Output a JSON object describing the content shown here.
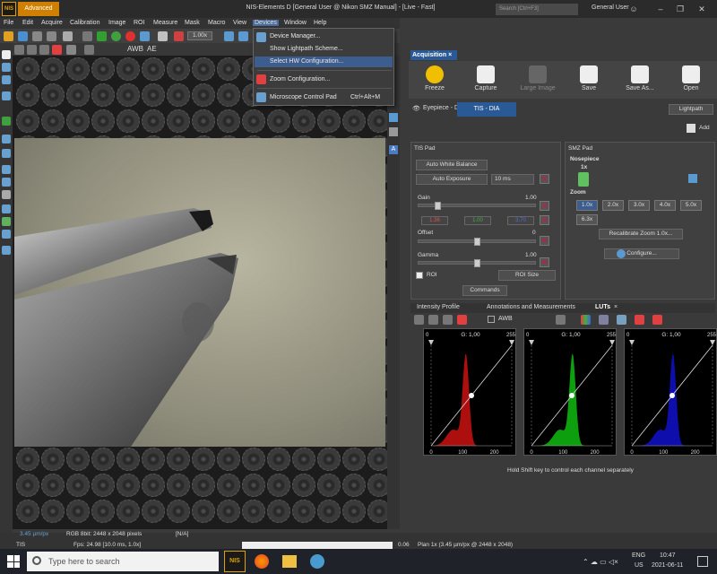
{
  "app": {
    "logo_text": "NIS",
    "mode_label": "Advanced",
    "window_title": "NIS-Elements D [General User @ Nikon SMZ Manual] - [Live - Fast]",
    "search_placeholder": "Search [Ctrl+F3]",
    "user": "General User"
  },
  "menus": [
    "File",
    "Edit",
    "Acquire",
    "Calibration",
    "Image",
    "ROI",
    "Measure",
    "Mask",
    "Macro",
    "View",
    "Devices",
    "Window",
    "Help"
  ],
  "toolbar": {
    "zoom": "1.00x",
    "awb": "AWB",
    "ae": "AE"
  },
  "devices_menu": {
    "items": [
      {
        "label": "Device Manager...",
        "shortcut": ""
      },
      {
        "label": "Show Lightpath Scheme...",
        "shortcut": ""
      },
      {
        "label": "Select HW Configuration...",
        "shortcut": ""
      },
      {
        "label": "Zoom Configuration...",
        "shortcut": ""
      },
      {
        "label": "Microscope Control Pad",
        "shortcut": "Ctrl+Alt+M"
      }
    ]
  },
  "acquisition": {
    "tab_label": "Acquisition",
    "close_symbol": "×",
    "buttons": [
      "Freeze",
      "Capture",
      "Large Image",
      "Save",
      "Save As...",
      "Open"
    ],
    "tabs": [
      "Eyepiece - DIA",
      "TIS - DIA"
    ],
    "lightpath": "Lightpath",
    "add": "Add"
  },
  "tis_pad": {
    "title": "TIS Pad",
    "auto_white_balance": "Auto White Balance",
    "auto_exposure": "Auto Exposure",
    "exposure_value": "10 ms",
    "gain_label": "Gain",
    "gain_value": "1.00",
    "rgb": [
      "1.36",
      "1.00",
      "3.70"
    ],
    "offset_label": "Offset",
    "offset_value": "0",
    "gamma_label": "Gamma",
    "gamma_value": "1.00",
    "roi_label": "ROI",
    "roi_size": "ROI Size",
    "commands": "Commands",
    "gain_level": 0.15,
    "offset_level": 0.5,
    "gamma_level": 0.5
  },
  "smz_pad": {
    "title": "SMZ Pad",
    "nosepiece_label": "Nosepiece",
    "nosepiece_value": "1x",
    "zoom_label": "Zoom",
    "zoom_levels": [
      "1.0x",
      "2.0x",
      "3.0x",
      "4.0x",
      "5.0x",
      "6.3x"
    ],
    "selected_zoom": "1.0x",
    "recalibrate": "Recalibrate Zoom 1.0x...",
    "configure": "Configure..."
  },
  "luts": {
    "tabs": [
      "Intensity Profile",
      "Annotations and Measurements",
      "LUTs"
    ],
    "awb": "AWB",
    "channels": [
      {
        "label": "G: 1,00",
        "color": "#c01010",
        "peak": 110
      },
      {
        "label": "G: 1,00",
        "color": "#10b010",
        "peak": 130
      },
      {
        "label": "G: 1,00",
        "color": "#1010c0",
        "peak": 130
      }
    ],
    "scale_min": "0",
    "scale_max": "255",
    "ticks": [
      "0",
      "100",
      "200"
    ],
    "hint": "Hold Shift key to control each channel separately"
  },
  "status": {
    "scale": "3.45 µm/px",
    "format": "RGB 8bit: 2448 x 2048 pixels",
    "na": "[N/A]",
    "camera": "TIS",
    "fps": "Fps: 24.98 [10.0 ms, 1.0x]",
    "value": "0.06",
    "objective": "Plan 1x (3.45 µm/px @ 2448 x 2048)"
  },
  "taskbar": {
    "search": "Type here to search",
    "nis": "NIS",
    "lang_top": "ENG",
    "lang_bottom": "US",
    "time": "10:47",
    "date": "2021-06-11"
  }
}
